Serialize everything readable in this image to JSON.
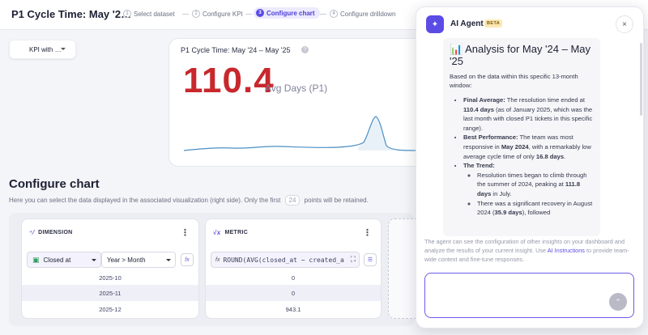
{
  "header": {
    "page_title": "P1 Cycle Time: May '2…",
    "steps": [
      {
        "num": "1",
        "label": "Select dataset"
      },
      {
        "num": "2",
        "label": "Configure KPI"
      },
      {
        "num": "3",
        "label": "Configure chart"
      },
      {
        "num": "4",
        "label": "Configure drilldown"
      }
    ],
    "active_step_index": 2
  },
  "kpi_selector": {
    "label": "KPI with …"
  },
  "kpi_card": {
    "title": "P1 Cycle Time: May '24 – May '25",
    "help_glyph": "?",
    "value": "110.4",
    "unit": "Avg Days (P1)",
    "accent_color": "#c8282d"
  },
  "configure": {
    "title": "Configure chart",
    "description_before": "Here you can select the data displayed in the associated visualization (right side). Only the first",
    "points": "24",
    "description_after": "points will be retained."
  },
  "dimension_panel": {
    "header": "DIMENSION",
    "field": "Closed at",
    "granularity": "Year > Month",
    "fx": "fx",
    "rows": [
      "2025-10",
      "2025-11",
      "2025-12"
    ]
  },
  "metric_panel": {
    "header": "METRIC",
    "fx": "fx",
    "expression": "ROUND(AVG(closed_at − created_a",
    "rows": [
      "0",
      "0",
      "943.1"
    ]
  },
  "ai_panel": {
    "title": "AI Agent",
    "badge": "BETA",
    "close": "×",
    "message": {
      "title": "📊 Analysis for May '24 – May '25",
      "intro": "Based on the data within this specific 13-month window:",
      "final_label": "Final Average:",
      "final_text_1": " The resolution time ended at ",
      "final_value": "110.4 days",
      "final_text_2": " (as of January 2025, which was the last month with closed P1 tickets in this specific range).",
      "best_label": "Best Performance:",
      "best_text_1": " The team was most responsive in ",
      "best_month": "May 2024",
      "best_text_2": ", with a remarkably low average cycle time of only ",
      "best_value": "16.8 days",
      "best_text_3": ".",
      "trend_label": "The Trend:",
      "trend_sub1_1": "Resolution times began to climb through the summer of 2024, peaking at ",
      "trend_sub1_value": "111.8 days",
      "trend_sub1_2": " in July.",
      "trend_sub2_1": "There was a significant recovery in August 2024 (",
      "trend_sub2_value": "35.9 days",
      "trend_sub2_2": "), followed"
    },
    "note_1": "The agent can see the configuration of other insights on your dashboard and analyze the results of your current insight. Use ",
    "note_link": "AI Instructions",
    "note_2": " to provide team-wide context and fine-tune responses.",
    "send_glyph": "⌃"
  }
}
